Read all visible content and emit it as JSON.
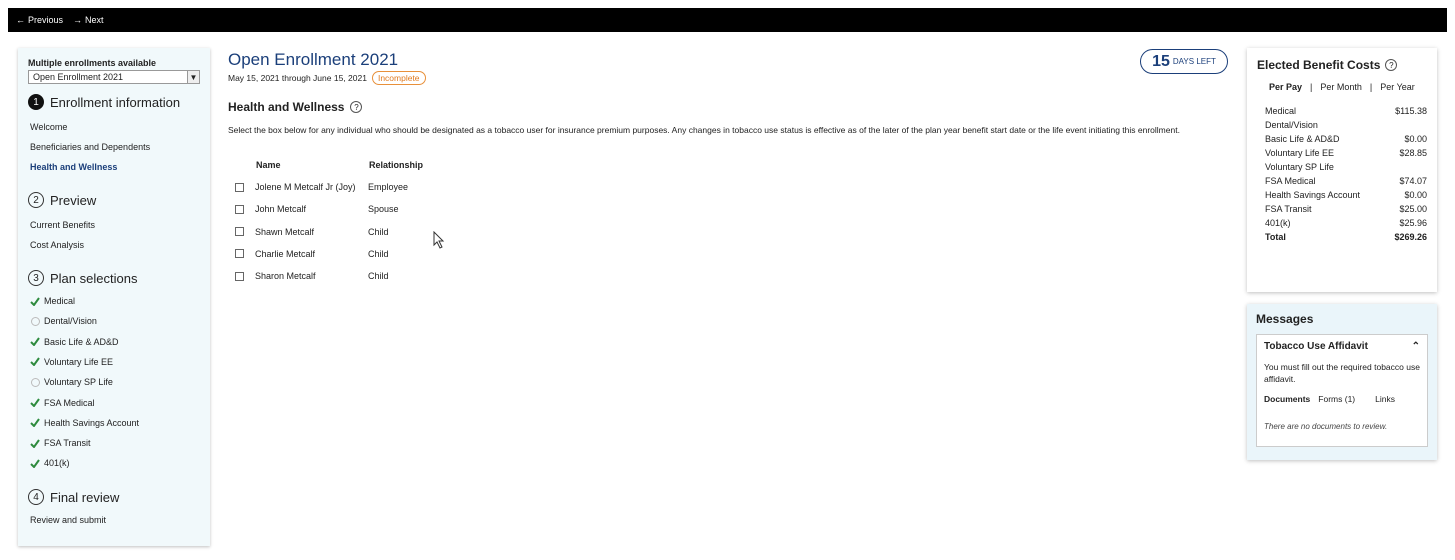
{
  "topbar": {
    "previous": "Previous",
    "next": "Next"
  },
  "sidebar": {
    "enroll_label": "Multiple enrollments available",
    "enroll_selected": "Open Enrollment 2021",
    "sections": [
      {
        "num": "1",
        "title": "Enrollment information"
      },
      {
        "num": "2",
        "title": "Preview"
      },
      {
        "num": "3",
        "title": "Plan selections"
      },
      {
        "num": "4",
        "title": "Final review"
      }
    ],
    "enrollment_items": [
      "Welcome",
      "Beneficiaries and Dependents",
      "Health and Wellness"
    ],
    "preview_items": [
      "Current Benefits",
      "Cost Analysis"
    ],
    "plans": [
      {
        "label": "Medical",
        "done": true
      },
      {
        "label": "Dental/Vision",
        "done": false
      },
      {
        "label": "Basic Life & AD&D",
        "done": true
      },
      {
        "label": "Voluntary Life EE",
        "done": true
      },
      {
        "label": "Voluntary SP Life",
        "done": false
      },
      {
        "label": "FSA Medical",
        "done": true
      },
      {
        "label": "Health Savings Account",
        "done": true
      },
      {
        "label": "FSA Transit",
        "done": true
      },
      {
        "label": "401(k)",
        "done": true
      }
    ],
    "final_items": [
      "Review and submit"
    ]
  },
  "main": {
    "title": "Open Enrollment 2021",
    "dates": "May 15, 2021 through June 15, 2021",
    "status": "Incomplete",
    "days_num": "15",
    "days_label": "DAYS LEFT",
    "section_title": "Health and Wellness",
    "description": "Select the box below for any individual who should be designated as a tobacco user for insurance premium purposes. Any changes in tobacco use status is effective as of the later of the plan year benefit start date or the life event initiating this enrollment.",
    "col_name": "Name",
    "col_relationship": "Relationship",
    "people": [
      {
        "name": "Jolene M Metcalf Jr (Joy)",
        "relationship": "Employee"
      },
      {
        "name": "John Metcalf",
        "relationship": "Spouse"
      },
      {
        "name": "Shawn Metcalf",
        "relationship": "Child"
      },
      {
        "name": "Charlie Metcalf",
        "relationship": "Child"
      },
      {
        "name": "Sharon Metcalf",
        "relationship": "Child"
      }
    ]
  },
  "costs": {
    "title": "Elected Benefit Costs",
    "tabs": [
      "Per Pay",
      "Per Month",
      "Per Year"
    ],
    "rows": [
      {
        "label": "Medical",
        "value": "$115.38"
      },
      {
        "label": "Dental/Vision",
        "value": ""
      },
      {
        "label": "Basic Life & AD&D",
        "value": "$0.00"
      },
      {
        "label": "Voluntary Life EE",
        "value": "$28.85"
      },
      {
        "label": "Voluntary SP Life",
        "value": ""
      },
      {
        "label": "FSA Medical",
        "value": "$74.07"
      },
      {
        "label": "Health Savings Account",
        "value": "$0.00"
      },
      {
        "label": "FSA Transit",
        "value": "$25.00"
      },
      {
        "label": "401(k)",
        "value": "$25.96"
      }
    ],
    "total_label": "Total",
    "total_value": "$269.26"
  },
  "messages": {
    "title": "Messages",
    "card_title": "Tobacco Use Affidavit",
    "card_text": "You must fill out the required tobacco use affidavit.",
    "tab_documents": "Documents",
    "tab_forms": "Forms (1)",
    "tab_links": "Links",
    "empty": "There are no documents to review."
  }
}
